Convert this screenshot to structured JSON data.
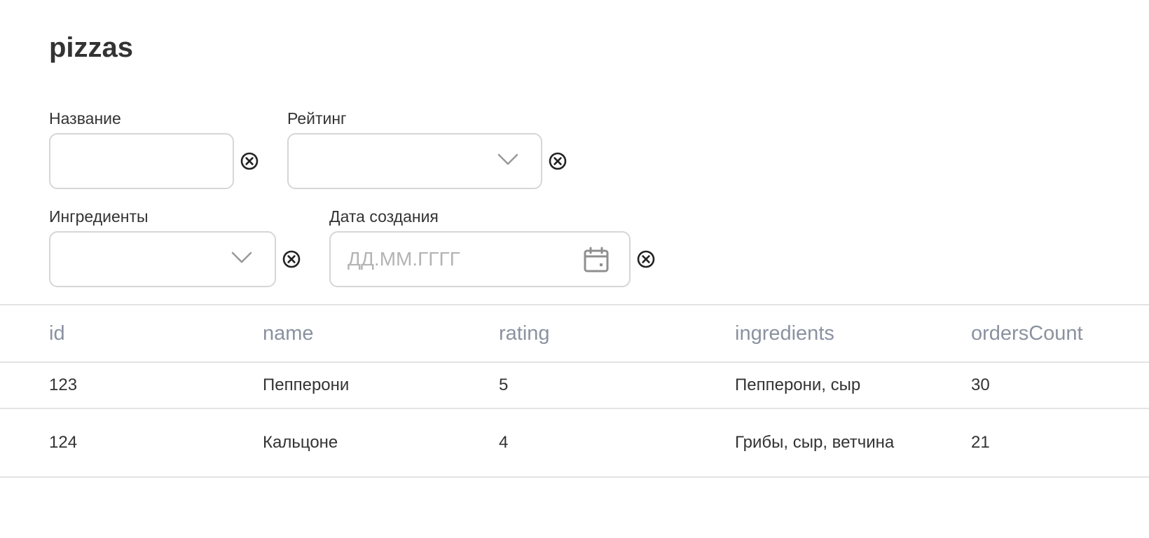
{
  "page": {
    "title": "pizzas"
  },
  "filters": {
    "name": {
      "label": "Название",
      "value": ""
    },
    "rating": {
      "label": "Рейтинг",
      "value": ""
    },
    "ingredients": {
      "label": "Ингредиенты",
      "value": ""
    },
    "created_date": {
      "label": "Дата создания",
      "value": "",
      "placeholder": "ДД.ММ.ГГГГ"
    }
  },
  "table": {
    "columns": [
      "id",
      "name",
      "rating",
      "ingredients",
      "ordersCount"
    ],
    "rows": [
      {
        "id": "123",
        "name": "Пепперони",
        "rating": "5",
        "ingredients": "Пепперони, сыр",
        "ordersCount": "30"
      },
      {
        "id": "124",
        "name": "Кальцоне",
        "rating": "4",
        "ingredients": "Грибы, сыр, ветчина",
        "ordersCount": "21"
      }
    ]
  },
  "icons": {
    "clear": "close-circle-icon",
    "dropdown": "chevron-down-icon",
    "date": "calendar-icon"
  },
  "colors": {
    "text": "#333333",
    "header_text": "#8a92a0",
    "border": "#d6d6d6",
    "placeholder": "#b4b4b4",
    "divider": "#e3e3e3"
  }
}
